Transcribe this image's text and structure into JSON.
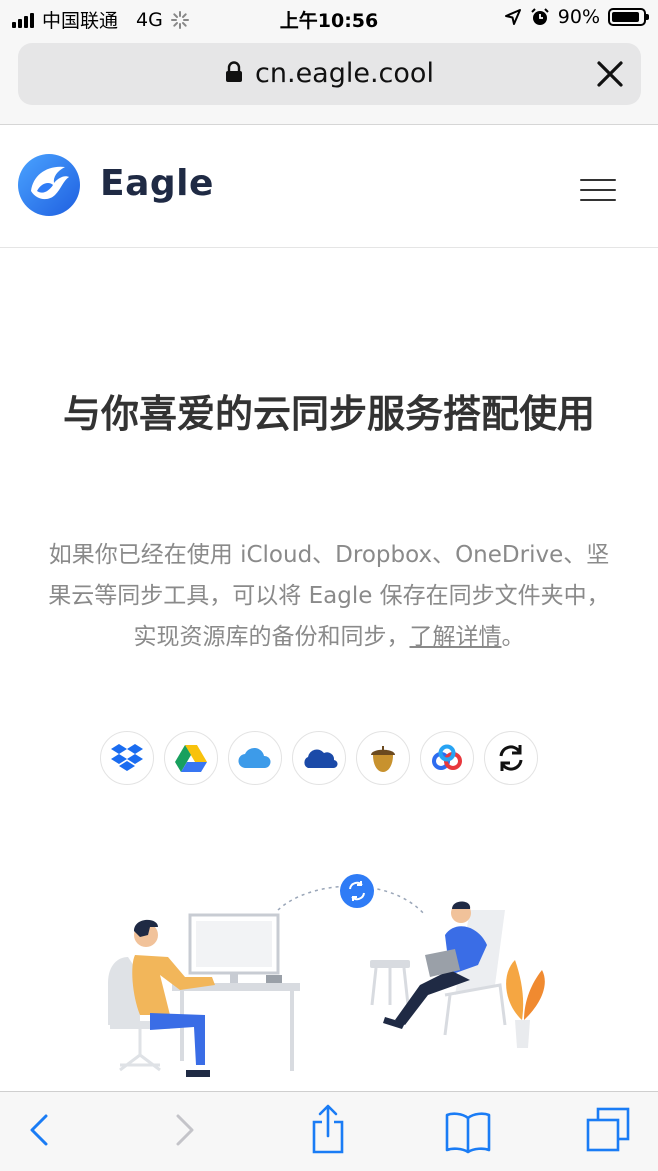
{
  "status_bar": {
    "carrier": "中国联通",
    "network": "4G",
    "time": "上午10:56",
    "battery_text": "90%",
    "battery_level": 0.9
  },
  "address_bar": {
    "url": "cn.eagle.cool"
  },
  "header": {
    "brand": "Eagle"
  },
  "hero": {
    "title": "与你喜爱的云同步服务搭配使用",
    "desc_text": "如果你已经在使用 iCloud、Dropbox、OneDrive、坚果云等同步工具，可以将 Eagle 保存在同步文件夹中，实现资源库的备份和同步，",
    "desc_link": "了解详情",
    "desc_end": "。"
  },
  "services": [
    {
      "icon": "dropbox-icon"
    },
    {
      "icon": "google-drive-icon"
    },
    {
      "icon": "icloud-icon"
    },
    {
      "icon": "onedrive-icon"
    },
    {
      "icon": "nutstore-icon"
    },
    {
      "icon": "baidu-cloud-icon"
    },
    {
      "icon": "sync-icon"
    }
  ],
  "colors": {
    "brand": "#2f7cf6",
    "ios_blue": "#1a7cf5",
    "text_dark": "#333333",
    "text_muted": "#8a8a8a"
  }
}
